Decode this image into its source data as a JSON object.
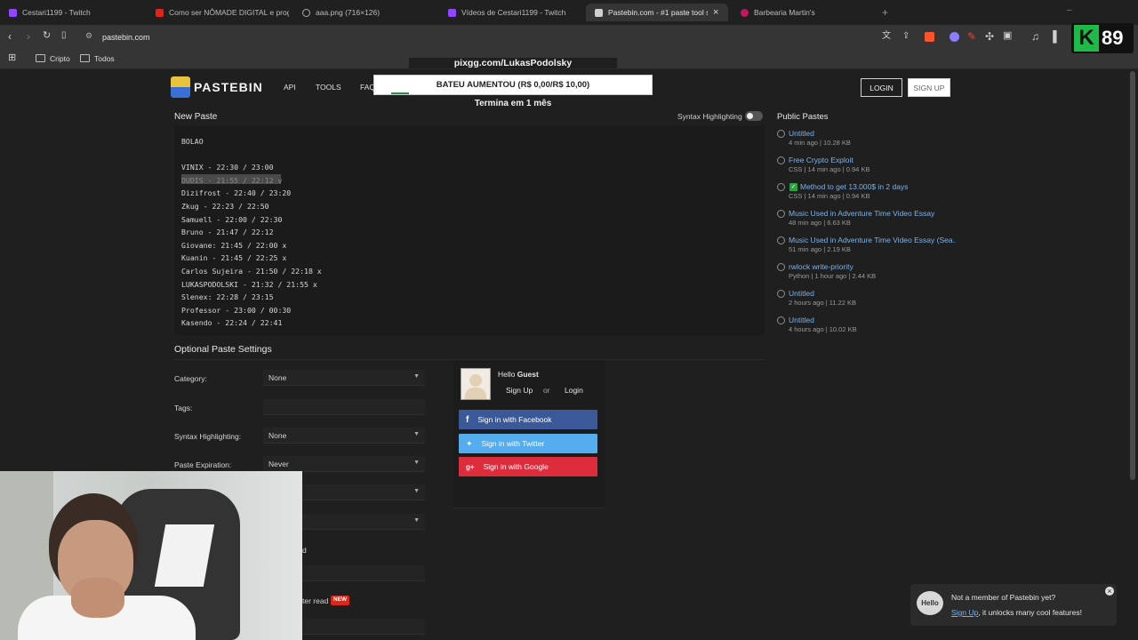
{
  "browser": {
    "tabs": [
      {
        "label": "Cestari1199 - Twitch"
      },
      {
        "label": "Como ser NÔMADE DIGITAL e progr..."
      },
      {
        "label": "aaa.png (716×126)"
      },
      {
        "label": "Vídeos de Cestari1199 - Twitch"
      },
      {
        "label": "Pastebin.com - #1 paste tool sin..."
      },
      {
        "label": "Barbearia Martin's"
      }
    ],
    "close_tab": "×",
    "new_tab": "+",
    "url": "pastebin.com",
    "bookmarks": [
      {
        "label": "Cripto"
      },
      {
        "label": "Todos"
      }
    ]
  },
  "overlay": {
    "pix_link": "pixgg.com/LukasPodolsky",
    "goal_text": "BATEU AUMENTOU (R$ 0,00/R$ 10,00)",
    "goal_progress": 0.0,
    "ends_in": "Termina em 1 mês",
    "badge_letter": "K",
    "badge_number": "89"
  },
  "pastebin": {
    "logo": "PASTEBIN",
    "nav": {
      "api": "API",
      "tools": "TOOLS",
      "faq": "FAQ"
    },
    "login": "LOGIN",
    "signup": "SIGN UP",
    "new_paste": "New Paste",
    "syntax_toggle_label": "Syntax Highlighting",
    "code_lines": [
      "BOLAO",
      "",
      "VINIX - 22:30 / 23:00",
      "DUDIS - 21:55 / 22:12 v",
      "Dizifrost - 22:40 / 23:20",
      "Zkug - 22:23 / 22:50",
      "Samuell - 22:00 / 22:30",
      "Bruno - 21:47 / 22:12",
      "Giovane: 21:45 / 22:00 x",
      "Kuanin - 21:45 / 22:25 x",
      "Carlos Sujeira - 21:50 / 22:18 x",
      "LUKASPODOLSKI - 21:32 / 21:55 x",
      "Slenex: 22:28 / 23:15",
      "Professor - 23:00 / 00:30",
      "Kasendo - 22:24 / 22:41"
    ],
    "public_pastes_title": "Public Pastes",
    "public_pastes": [
      {
        "title": "Untitled",
        "meta": "4 min ago | 10.28 KB"
      },
      {
        "title": "Free Crypto Exploit",
        "meta": "CSS | 14 min ago | 0.94 KB"
      },
      {
        "title": "Method to get 13.000$ in 2 days",
        "meta": "CSS | 14 min ago | 0.94 KB"
      },
      {
        "title": "Music Used in Adventure Time Video Essay",
        "meta": "48 min ago | 6.63 KB"
      },
      {
        "title": "Music Used in Adventure Time Video Essay (Sea...",
        "meta": "51 min ago | 2.19 KB"
      },
      {
        "title": "rwlock write-priority",
        "meta": "Python | 1 hour ago | 2.44 KB"
      },
      {
        "title": "Untitled",
        "meta": "2 hours ago | 11.22 KB"
      },
      {
        "title": "Untitled",
        "meta": "4 hours ago | 10.02 KB"
      }
    ],
    "optional_settings_title": "Optional Paste Settings",
    "settings": [
      {
        "label": "Category:",
        "value": "None"
      },
      {
        "label": "Tags:",
        "value": ""
      },
      {
        "label": "Syntax Highlighting:",
        "value": "None"
      },
      {
        "label": "Paste Expiration:",
        "value": "Never"
      }
    ],
    "partial_label_d": "d",
    "partial_label_read": "ter read",
    "new_badge": "NEW",
    "guest": {
      "hello": "Hello",
      "name": "Guest",
      "signup": "Sign Up",
      "or": "or",
      "login": "Login"
    },
    "social": {
      "facebook": "Sign in with Facebook",
      "twitter": "Sign in with Twitter",
      "google": "Sign in with Google"
    },
    "member_popup": {
      "line1": "Not a member of Pastebin yet?",
      "signup_link": "Sign Up",
      "line2": ", it unlocks many cool features!",
      "close": "×"
    }
  },
  "colors": {
    "facebook": "#3b5998",
    "twitter": "#55acee",
    "google": "#dd2c3b",
    "link": "#7db2e6",
    "twitch": "#9146ff",
    "badge_green": "#1fb94a"
  }
}
